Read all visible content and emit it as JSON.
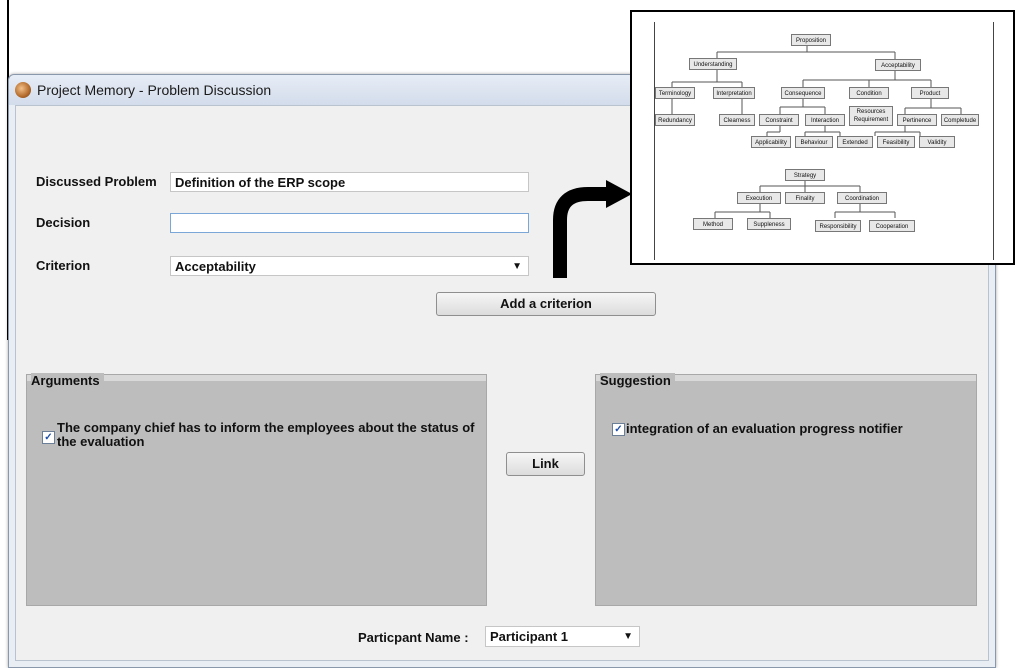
{
  "window": {
    "title": "Project Memory - Problem Discussion"
  },
  "form": {
    "discussed_problem": {
      "label": "Discussed Problem",
      "value": "Definition of the ERP scope"
    },
    "decision": {
      "label": "Decision",
      "value": ""
    },
    "criterion": {
      "label": "Criterion",
      "value": "Acceptability"
    },
    "add_criterion_label": "Add a criterion"
  },
  "arguments": {
    "title": "Arguments",
    "items": [
      {
        "checked": true,
        "text": "The company chief has to inform the employees about the status of the evaluation"
      }
    ]
  },
  "link_label": "Link",
  "suggestion": {
    "title": "Suggestion",
    "items": [
      {
        "checked": true,
        "text": "integration of an evaluation progress  notifier"
      }
    ]
  },
  "participant": {
    "label": "Particpant Name :",
    "value": "Participant 1"
  },
  "diagram": {
    "tree1": {
      "root": "Proposition",
      "understanding": "Understanding",
      "acceptability": "Acceptability",
      "terminology": "Terminology",
      "interpretation": "Interpretation",
      "consequence": "Consequence",
      "condition": "Condition",
      "product": "Product",
      "redundancy": "Redundancy",
      "clearness": "Clearness",
      "constraint": "Constraint",
      "interaction": "Interaction",
      "resources_line1": "Resources",
      "resources_line2": "Requirement",
      "pertinence": "Pertinence",
      "completude": "Completude",
      "applicability": "Applicability",
      "behaviour": "Behaviour",
      "extended": "Extended",
      "feasibility": "Feasibility",
      "validity": "Validity"
    },
    "tree2": {
      "root": "Strategy",
      "execution": "Execution",
      "finality": "Finality",
      "coordination": "Coordination",
      "method": "Method",
      "suppleness": "Suppleness",
      "responsibility": "Responsibility",
      "cooperation": "Cooperation"
    }
  }
}
